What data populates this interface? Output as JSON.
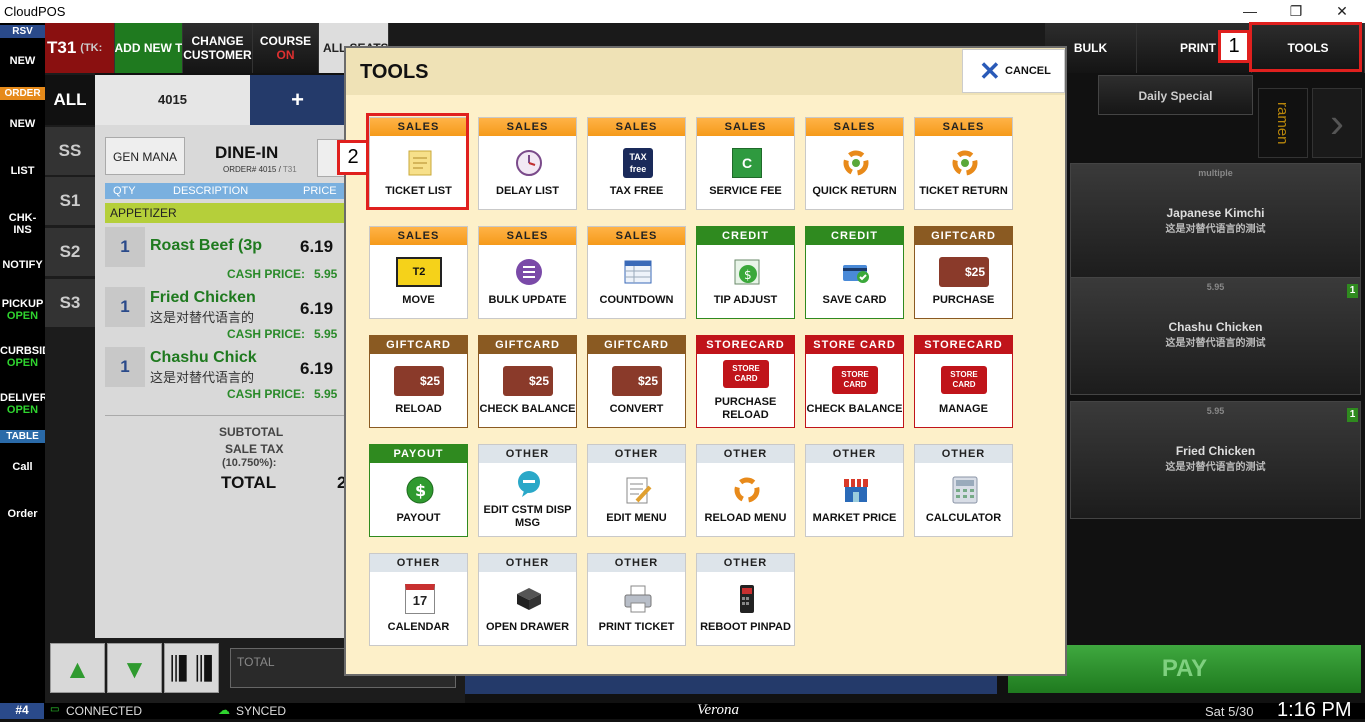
{
  "app": {
    "title": "CloudPOS"
  },
  "window": {
    "minimize": "—",
    "restore": "❐",
    "close": "✕"
  },
  "rail": {
    "rsv_label": "RSV",
    "new1": "NEW",
    "order_label": "ORDER",
    "new2": "NEW",
    "list": "LIST",
    "chkins": "CHK-INS",
    "notify": "NOTIFY",
    "pickup": "PICKUP",
    "pickup_status": "OPEN",
    "curbside": "CURBSID",
    "curbside_status": "OPEN",
    "delivery": "DELIVER",
    "delivery_status": "OPEN",
    "table_label": "TABLE",
    "call": "Call",
    "order": "Order"
  },
  "topbar": {
    "ticket_num": "T31",
    "ticket_suffix": "(TK:",
    "add_new": "ADD NEW T",
    "change_customer": "CHANGE CUSTOMER",
    "course": "COURSE",
    "course_state": "ON",
    "all_seats": "ALL SEATS",
    "bulk": "BULK",
    "print": "PRINT",
    "tools": "TOOLS"
  },
  "seats": {
    "all": "ALL",
    "ss": "SS",
    "s1": "S1",
    "s2": "S2",
    "s3": "S3",
    "ticket_id": "4015",
    "add": "+"
  },
  "ticket": {
    "server": "GEN MANA",
    "mode": "DINE-IN",
    "order_ref_label": "ORDER# 4015 / ",
    "order_ref_table": "T31",
    "headers": [
      "QTY",
      "DESCRIPTION",
      "PRICE"
    ],
    "category": "APPETIZER",
    "items": [
      {
        "qty": "1",
        "name": "Roast Beef (3p",
        "alt": "",
        "price": "6.19",
        "cash_label": "CASH PRICE:",
        "cash_price": "5.95"
      },
      {
        "qty": "1",
        "name": "Fried Chicken",
        "alt": "这是对替代语言的",
        "price": "6.19",
        "cash_label": "CASH PRICE:",
        "cash_price": "5.95"
      },
      {
        "qty": "1",
        "name": "Chashu Chick",
        "alt": "这是对替代语言的",
        "price": "6.19",
        "cash_label": "CASH PRICE:",
        "cash_price": "5.95"
      }
    ],
    "subtotal_label": "SUBTOTAL",
    "tax_label": "SALE TAX",
    "tax_rate": "(10.750%):",
    "total_label": "TOTAL",
    "total_partial": "2",
    "total_field_placeholder": "TOTAL"
  },
  "modal": {
    "title": "TOOLS",
    "cancel": "CANCEL",
    "tiles": [
      {
        "cat": "SALES",
        "label": "TICKET LIST",
        "icon": "ticket-list-icon"
      },
      {
        "cat": "SALES",
        "label": "DELAY LIST",
        "icon": "delay-clock-icon"
      },
      {
        "cat": "SALES",
        "label": "TAX FREE",
        "icon": "tax-free-icon",
        "icon_text": "TAX free"
      },
      {
        "cat": "SALES",
        "label": "SERVICE FEE",
        "icon": "service-charge-icon",
        "icon_text": "C"
      },
      {
        "cat": "SALES",
        "label": "QUICK RETURN",
        "icon": "return-arrows-icon"
      },
      {
        "cat": "SALES",
        "label": "TICKET RETURN",
        "icon": "return-arrows-icon"
      },
      {
        "cat": "SALES",
        "label": "MOVE",
        "icon": "move-icon",
        "icon_text": "T2"
      },
      {
        "cat": "SALES",
        "label": "BULK UPDATE",
        "icon": "bulk-list-icon"
      },
      {
        "cat": "SALES",
        "label": "COUNTDOWN",
        "icon": "countdown-table-icon"
      },
      {
        "cat": "CREDIT",
        "label": "TIP ADJUST",
        "icon": "tip-dollar-icon"
      },
      {
        "cat": "CREDIT",
        "label": "SAVE CARD",
        "icon": "save-card-icon"
      },
      {
        "cat": "GIFTCARD",
        "label": "PURCHASE",
        "icon": "gift-card-icon",
        "icon_text": "$25"
      },
      {
        "cat": "GIFTCARD",
        "label": "RELOAD",
        "icon": "gift-card-icon",
        "icon_text": "$25"
      },
      {
        "cat": "GIFTCARD",
        "label": "CHECK BALANCE",
        "icon": "gift-card-icon",
        "icon_text": "$25"
      },
      {
        "cat": "GIFTCARD",
        "label": "CONVERT",
        "icon": "gift-card-icon",
        "icon_text": "$25"
      },
      {
        "cat": "STORECARD",
        "label": "PURCHASE RELOAD",
        "icon": "store-card-icon",
        "icon_text": "STORE CARD"
      },
      {
        "cat": "STORE CARD",
        "label": "CHECK BALANCE",
        "icon": "store-card-icon",
        "icon_text": "STORE CARD"
      },
      {
        "cat": "STORECARD",
        "label": "MANAGE",
        "icon": "store-card-icon",
        "icon_text": "STORE CARD"
      },
      {
        "cat": "PAYOUT",
        "label": "PAYOUT",
        "icon": "payout-dollar-icon"
      },
      {
        "cat": "OTHER",
        "label": "EDIT CSTM DISP MSG",
        "icon": "message-bubble-icon"
      },
      {
        "cat": "OTHER",
        "label": "EDIT MENU",
        "icon": "edit-menu-icon"
      },
      {
        "cat": "OTHER",
        "label": "RELOAD MENU",
        "icon": "reload-arrows-icon"
      },
      {
        "cat": "OTHER",
        "label": "MARKET PRICE",
        "icon": "market-store-icon"
      },
      {
        "cat": "OTHER",
        "label": "CALCULATOR",
        "icon": "calculator-icon"
      },
      {
        "cat": "OTHER",
        "label": "CALENDAR",
        "icon": "calendar-icon",
        "icon_text": "17"
      },
      {
        "cat": "OTHER",
        "label": "OPEN DRAWER",
        "icon": "cash-drawer-icon"
      },
      {
        "cat": "OTHER",
        "label": "PRINT TICKET",
        "icon": "printer-icon"
      },
      {
        "cat": "OTHER",
        "label": "REBOOT PINPAD",
        "icon": "pinpad-icon"
      }
    ]
  },
  "right": {
    "daily_special": "Daily Special",
    "ramen": "ramen",
    "multiple": "multiple",
    "cards": [
      {
        "price": "",
        "name": "Japanese Kimchi",
        "alt": "这是对替代语言的测试",
        "badge": ""
      },
      {
        "price": "5.95",
        "name": "Chashu Chicken",
        "alt": "这是对替代语言的测试",
        "badge": "1"
      },
      {
        "price": "5.95",
        "name": "Fried Chicken",
        "alt": "这是对替代语言的测试",
        "badge": "1"
      }
    ],
    "pay": "PAY"
  },
  "status": {
    "station": "#4",
    "connected": "CONNECTED",
    "synced": "SYNCED",
    "location": "Verona",
    "date": "Sat 5/30",
    "time": "1:16 PM"
  },
  "annotations": {
    "marker1": "1",
    "marker2": "2"
  },
  "colors": {
    "sales": "#f59a1a",
    "credit": "#2f8a1f",
    "giftcard": "#8a5a22",
    "storecard": "#c0141a",
    "other": "#dde4ea",
    "highlight": "#e0201e"
  }
}
